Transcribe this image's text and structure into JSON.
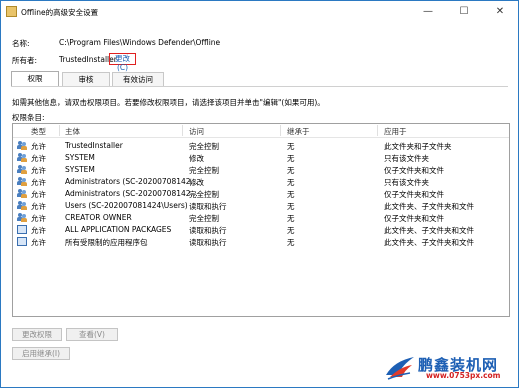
{
  "window": {
    "title": "Offline的高级安全设置",
    "minimize": "—",
    "maximize": "☐",
    "close": "✕"
  },
  "object": {
    "name_label": "名称:",
    "name_value": "C:\\Program Files\\Windows Defender\\Offline",
    "owner_label": "所有者:",
    "owner_value": "TrustedInstaller",
    "change_link": "更改(C)",
    "highlight_color": "#e02020"
  },
  "tabs": [
    {
      "label": "权限",
      "active": true
    },
    {
      "label": "审核",
      "active": false
    },
    {
      "label": "有效访问",
      "active": false
    }
  ],
  "info_text": "如需其他信息，请双击权限项目。若要修改权限项目，请选择该项目并单击\"编辑\"(如果可用)。",
  "list_label": "权限条目:",
  "table": {
    "headers": [
      "类型",
      "主体",
      "访问",
      "继承于",
      "应用于"
    ],
    "rows": [
      {
        "icon": "users-icon",
        "type": "允许",
        "principal": "TrustedInstaller",
        "access": "完全控制",
        "inherited": "无",
        "applies": "此文件夹和子文件夹"
      },
      {
        "icon": "users-icon",
        "type": "允许",
        "principal": "SYSTEM",
        "access": "修改",
        "inherited": "无",
        "applies": "只有该文件夹"
      },
      {
        "icon": "users-icon",
        "type": "允许",
        "principal": "SYSTEM",
        "access": "完全控制",
        "inherited": "无",
        "applies": "仅子文件夹和文件"
      },
      {
        "icon": "users-icon",
        "type": "允许",
        "principal": "Administrators (SC-20200708142...",
        "access": "修改",
        "inherited": "无",
        "applies": "只有该文件夹"
      },
      {
        "icon": "users-icon",
        "type": "允许",
        "principal": "Administrators (SC-20200708142...",
        "access": "完全控制",
        "inherited": "无",
        "applies": "仅子文件夹和文件"
      },
      {
        "icon": "users-icon",
        "type": "允许",
        "principal": "Users (SC-202007081424\\Users)",
        "access": "读取和执行",
        "inherited": "无",
        "applies": "此文件夹、子文件夹和文件"
      },
      {
        "icon": "users-icon",
        "type": "允许",
        "principal": "CREATOR OWNER",
        "access": "完全控制",
        "inherited": "无",
        "applies": "仅子文件夹和文件"
      },
      {
        "icon": "package-icon",
        "type": "允许",
        "principal": "ALL APPLICATION PACKAGES",
        "access": "读取和执行",
        "inherited": "无",
        "applies": "此文件夹、子文件夹和文件"
      },
      {
        "icon": "package-icon",
        "type": "允许",
        "principal": "所有受限制的应用程序包",
        "access": "读取和执行",
        "inherited": "无",
        "applies": "此文件夹、子文件夹和文件"
      }
    ]
  },
  "buttons": {
    "change_permissions": "更改权限",
    "view": "查看(V)",
    "enable_inheritance": "启用继承(I)"
  },
  "watermark": {
    "title": "鹏鑫装机网",
    "url": "www.0753px.com"
  }
}
